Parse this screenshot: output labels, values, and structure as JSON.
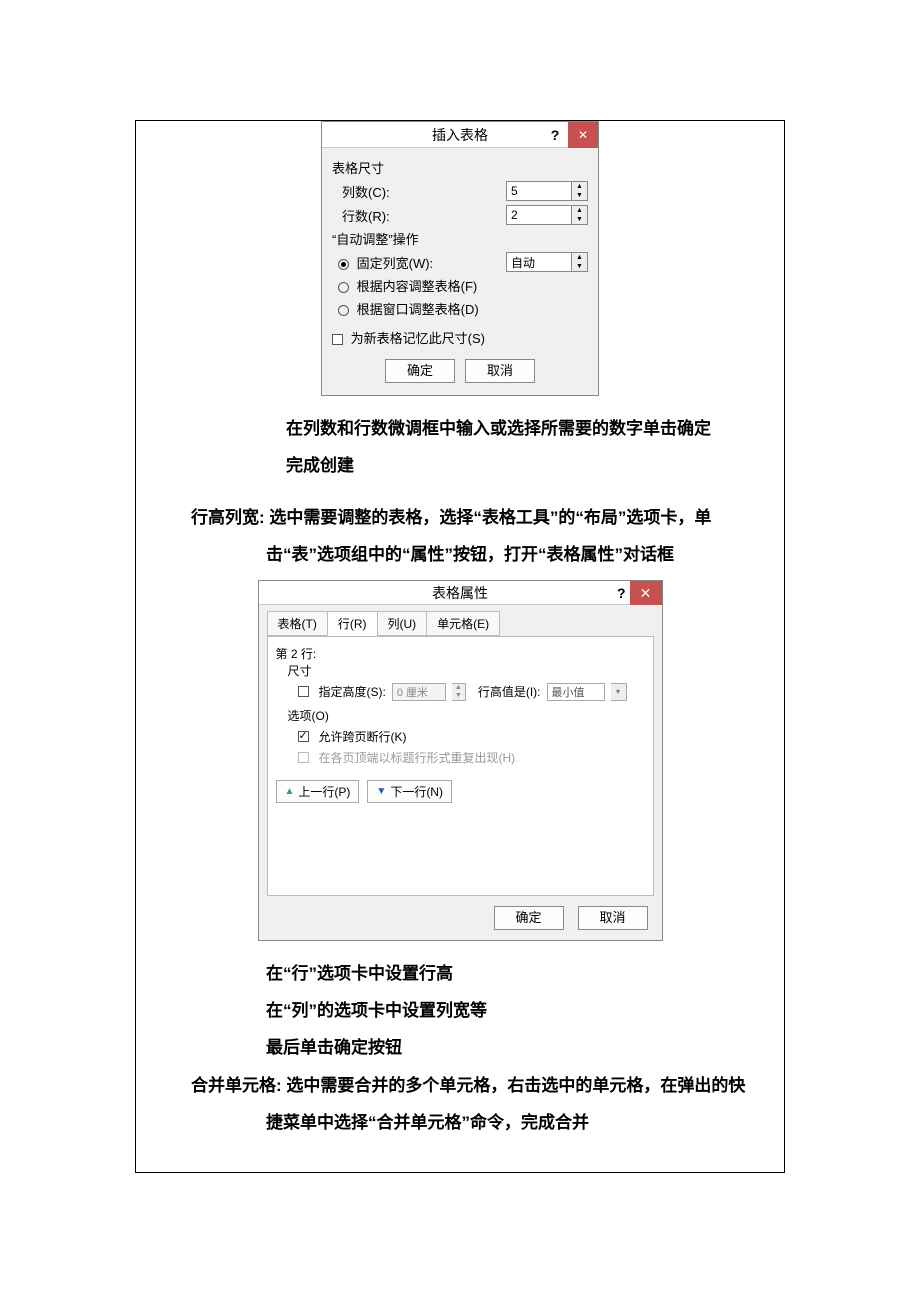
{
  "dialog1": {
    "title": "插入表格",
    "help": "?",
    "close": "✕",
    "group_size": "表格尺寸",
    "cols_label": "列数(C):",
    "cols_value": "5",
    "rows_label": "行数(R):",
    "rows_value": "2",
    "group_autofit": "“自动调整”操作",
    "opt_fixed": "固定列宽(W):",
    "fixed_value": "自动",
    "opt_content": "根据内容调整表格(F)",
    "opt_window": "根据窗口调整表格(D)",
    "remember": "为新表格记忆此尺寸(S)",
    "ok": "确定",
    "cancel": "取消"
  },
  "text": {
    "p1": "在列数和行数微调框中输入或选择所需要的数字单击确定",
    "p2": "完成创建",
    "p3a": "行高列宽:",
    "p3b": "选中需要调整的表格，选择“表格工具”的“布局”选项卡，单",
    "p4": "击“表”选项组中的“属性”按钮，打开“表格属性”对话框",
    "p5": "在“行”选项卡中设置行高",
    "p6": "在“列”的选项卡中设置列宽等",
    "p7": "最后单击确定按钮",
    "p8a": "合并单元格:",
    "p8b": "选中需要合并的多个单元格，右击选中的单元格，在弹出的快",
    "p9": "捷菜单中选择“合并单元格”命令，完成合并"
  },
  "dialog2": {
    "title": "表格属性",
    "help": "?",
    "close": "✕",
    "tab_table": "表格(T)",
    "tab_row": "行(R)",
    "tab_col": "列(U)",
    "tab_cell": "单元格(E)",
    "row_header": "第 2 行:",
    "size_label": "尺寸",
    "spec_height": "指定高度(S):",
    "height_value": "0 厘米",
    "height_is": "行高值是(I):",
    "height_type": "最小值",
    "options_label": "选项(O)",
    "opt_break": "允许跨页断行(K)",
    "opt_header": "在各页顶端以标题行形式重复出现(H)",
    "prev_row": "上一行(P)",
    "next_row": "下一行(N)",
    "ok": "确定",
    "cancel": "取消"
  }
}
